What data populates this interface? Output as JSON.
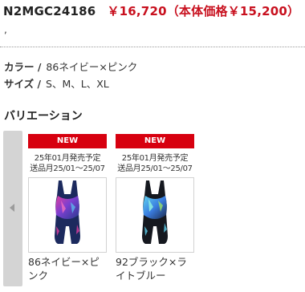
{
  "product": {
    "code": "N2MGC24186",
    "price_text": "￥16,720（本体価格￥15,200）",
    "sub_text": ","
  },
  "attributes": {
    "color_label": "カラー /",
    "color_value": "86ネイビー×ピンク",
    "size_label": "サイズ /",
    "size_value": "S、M、L、XL"
  },
  "variations": {
    "title": "バリエーション",
    "items": [
      {
        "badge": "NEW",
        "note_line1": "25年01月発売予定",
        "note_line2": "送品月25/01～25/07",
        "label": "86ネイビー×ピンク",
        "icon": "swimsuit-navy-pink",
        "body_color": "#1c2a5e"
      },
      {
        "badge": "NEW",
        "note_line1": "25年01月発売予定",
        "note_line2": "送品月25/01～25/07",
        "label": "92ブラック×ライトブルー",
        "icon": "swimsuit-black-lightblue",
        "body_color": "#15181f"
      }
    ]
  },
  "controls": {
    "prev_icon": "chevron-left-icon"
  },
  "colors": {
    "price_red": "#c8101e",
    "badge_red": "#d7000f"
  }
}
